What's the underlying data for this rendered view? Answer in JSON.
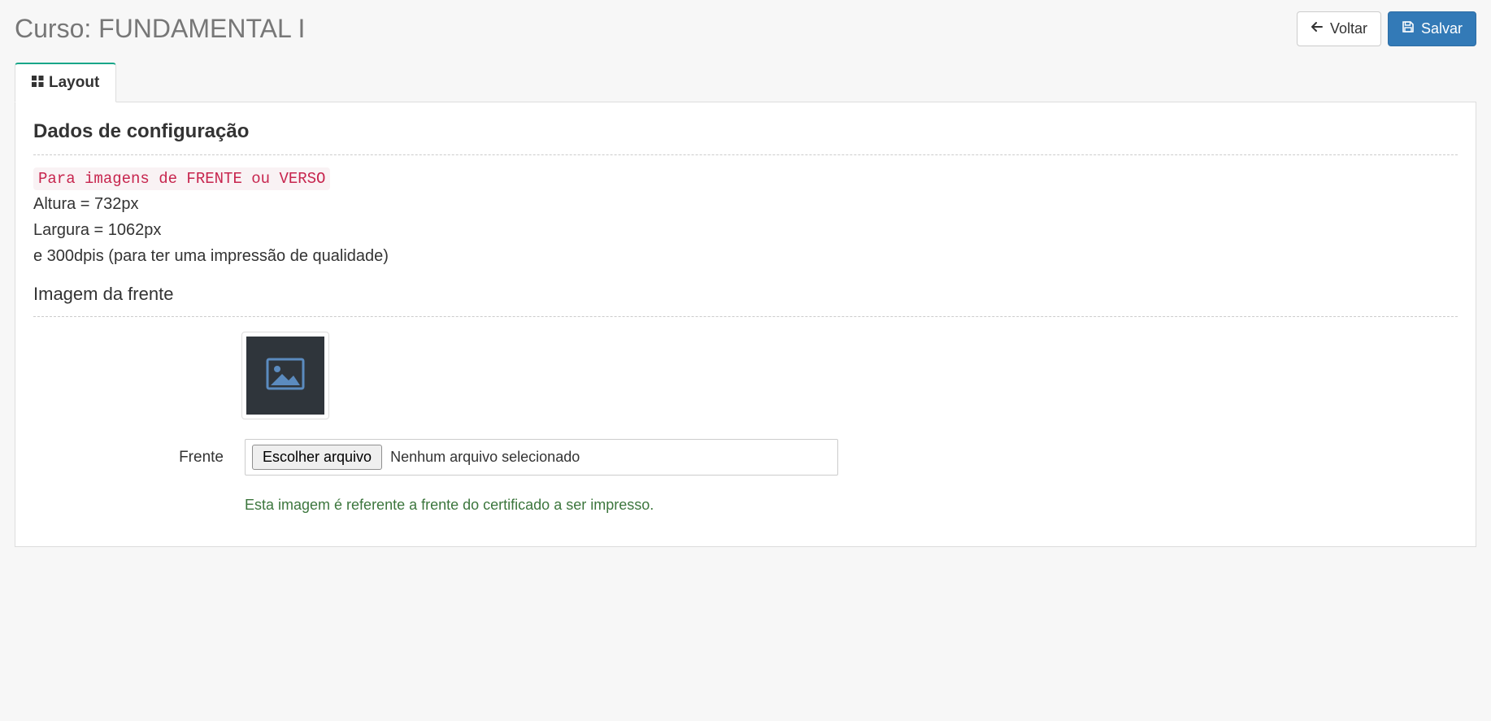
{
  "header": {
    "title": "Curso: FUNDAMENTAL I",
    "back_label": "Voltar",
    "save_label": "Salvar"
  },
  "tabs": {
    "layout_label": "Layout"
  },
  "config": {
    "section_title": "Dados de configuração",
    "hint_code": "Para imagens de FRENTE ou VERSO",
    "spec_height": "Altura = 732px",
    "spec_width": "Largura = 1062px",
    "spec_dpi": "e 300dpis (para ter uma impressão de qualidade)"
  },
  "front": {
    "sub_title": "Imagem da frente",
    "field_label": "Frente",
    "choose_file_label": "Escolher arquivo",
    "no_file_text": "Nenhum arquivo selecionado",
    "help_text": "Esta imagem é referente a frente do certificado a ser impresso."
  }
}
